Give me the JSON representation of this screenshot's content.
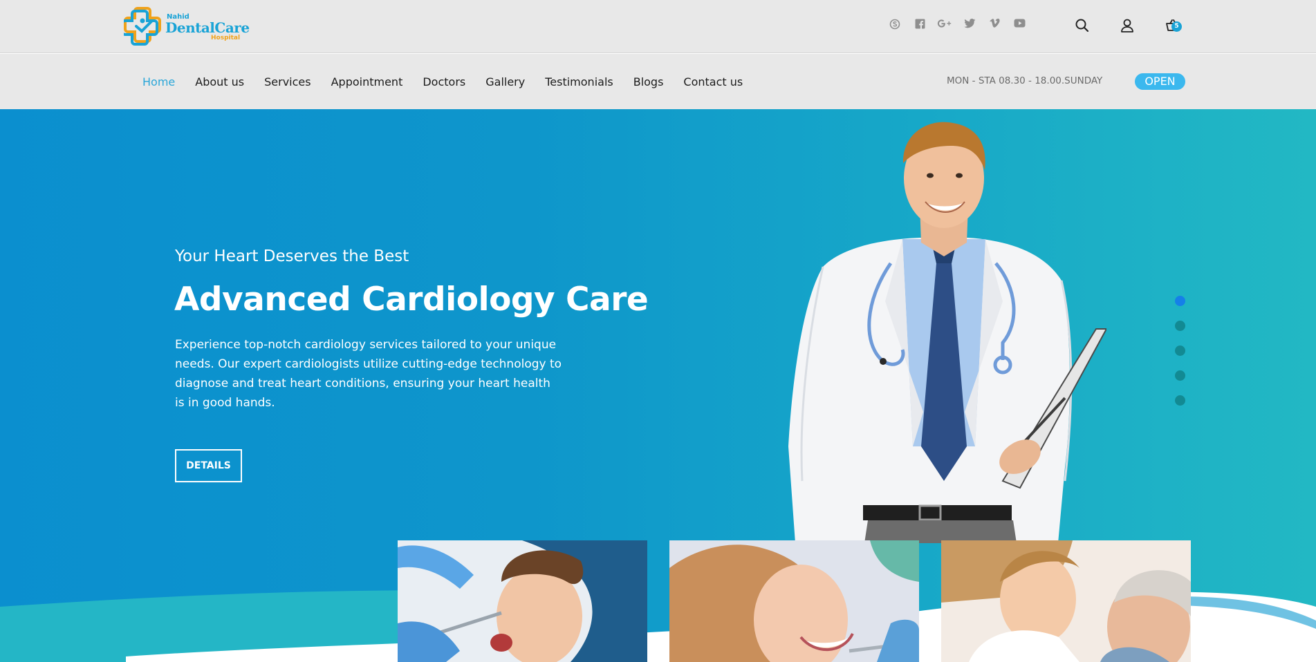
{
  "brand": {
    "line1": "Nahid",
    "line2": "DentalCare",
    "line3": "Hospital"
  },
  "social_icons": [
    "skype-icon",
    "facebook-icon",
    "google-plus-icon",
    "twitter-icon",
    "vimeo-icon",
    "youtube-icon"
  ],
  "tools": {
    "search_icon": "search-icon",
    "user_icon": "user-icon",
    "cart_icon": "cart-icon",
    "cart_count": "5"
  },
  "nav": {
    "items": [
      "Home",
      "About us",
      "Services",
      "Appointment",
      "Doctors",
      "Gallery",
      "Testimonials",
      "Blogs",
      "Contact us"
    ],
    "active": "Home"
  },
  "hours": "MON - STA 08.30 - 18.00.SUNDAY",
  "open_label": "OPEN",
  "hero": {
    "subtitle": "Your Heart Deserves the Best",
    "title": "Advanced Cardiology Care",
    "description": "Experience top-notch cardiology services tailored to your unique needs. Our expert cardiologists utilize cutting-edge technology to diagnose and treat heart conditions, ensuring your heart health is in good hands.",
    "button": "DETAILS"
  },
  "slider": {
    "count": 5,
    "active_index": 0
  },
  "colors": {
    "accent": "#2aa6d8",
    "hero_start": "#0b8fcf",
    "hero_end": "#22b8c4",
    "open_pill": "#3bb8ee",
    "active_dot": "#1580e8",
    "logo_orange": "#f0a21b"
  }
}
